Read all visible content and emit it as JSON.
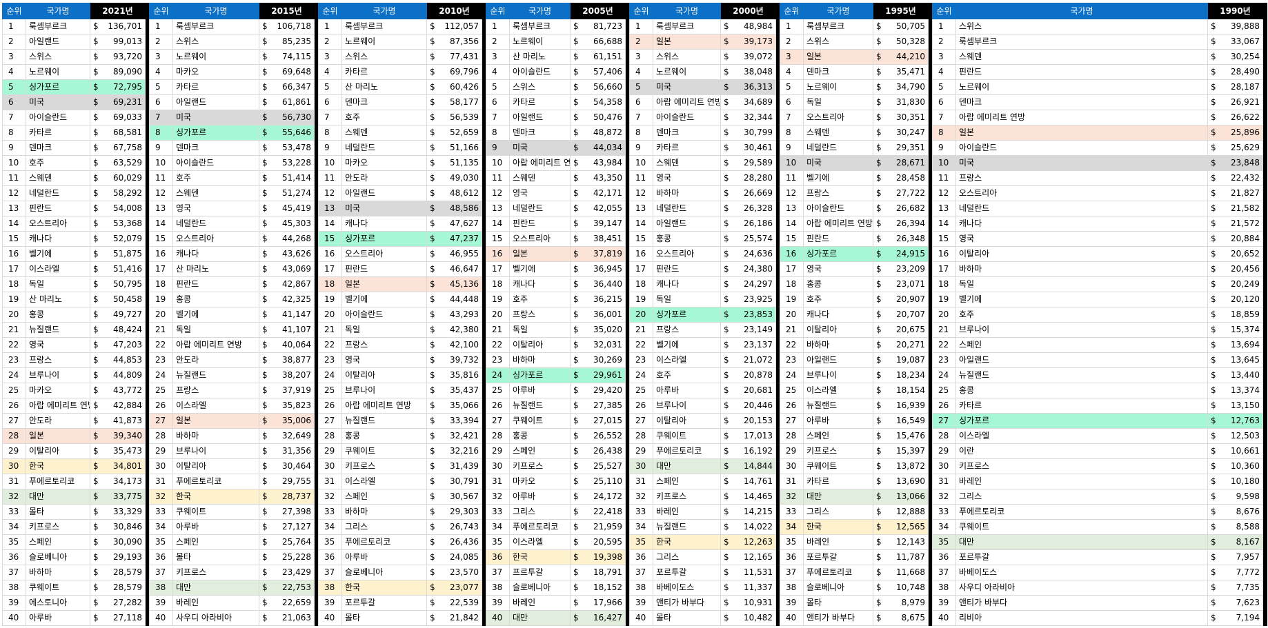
{
  "header": {
    "rank": "순위",
    "country": "국가명"
  },
  "currency": "$",
  "highlight_colors": {
    "싱가포르": "#a6f7d5",
    "미국": "#d9d9d9",
    "일본": "#fce3d8",
    "한국": "#fef1cd",
    "대만": "#e1eedd"
  },
  "tables": [
    {
      "year": "2021년",
      "rows": [
        [
          "룩셈부르크",
          "136,701"
        ],
        [
          "아일랜드",
          "99,013"
        ],
        [
          "스위스",
          "93,720"
        ],
        [
          "노르웨이",
          "89,090"
        ],
        [
          "싱가포르",
          "72,795"
        ],
        [
          "미국",
          "69,231"
        ],
        [
          "아이슬란드",
          "69,033"
        ],
        [
          "카타르",
          "68,581"
        ],
        [
          "덴마크",
          "67,758"
        ],
        [
          "호주",
          "63,529"
        ],
        [
          "스웨덴",
          "60,029"
        ],
        [
          "네덜란드",
          "58,292"
        ],
        [
          "핀란드",
          "54,008"
        ],
        [
          "오스트리아",
          "53,368"
        ],
        [
          "캐나다",
          "52,079"
        ],
        [
          "벨기에",
          "51,875"
        ],
        [
          "이스라엘",
          "51,416"
        ],
        [
          "독일",
          "50,795"
        ],
        [
          "산 마리노",
          "50,458"
        ],
        [
          "홍콩",
          "49,727"
        ],
        [
          "뉴질랜드",
          "48,424"
        ],
        [
          "영국",
          "47,203"
        ],
        [
          "프랑스",
          "44,853"
        ],
        [
          "브루나이",
          "44,809"
        ],
        [
          "마카오",
          "43,772"
        ],
        [
          "아랍 에미리트 연방",
          "42,884"
        ],
        [
          "안도라",
          "41,873"
        ],
        [
          "일본",
          "39,340"
        ],
        [
          "이탈리아",
          "35,473"
        ],
        [
          "한국",
          "34,801"
        ],
        [
          "푸에르토리코",
          "34,173"
        ],
        [
          "대만",
          "33,775"
        ],
        [
          "몰타",
          "33,329"
        ],
        [
          "키프로스",
          "30,846"
        ],
        [
          "스페인",
          "30,090"
        ],
        [
          "슬로베니아",
          "29,193"
        ],
        [
          "바하마",
          "28,579"
        ],
        [
          "쿠웨이트",
          "28,579"
        ],
        [
          "에스토니아",
          "27,282"
        ],
        [
          "아루바",
          "27,118"
        ]
      ]
    },
    {
      "year": "2015년",
      "rows": [
        [
          "룩셈부르크",
          "106,718"
        ],
        [
          "스위스",
          "85,235"
        ],
        [
          "노르웨이",
          "74,115"
        ],
        [
          "마카오",
          "69,648"
        ],
        [
          "카타르",
          "66,347"
        ],
        [
          "아일랜드",
          "61,861"
        ],
        [
          "미국",
          "56,730"
        ],
        [
          "싱가포르",
          "55,646"
        ],
        [
          "덴마크",
          "53,478"
        ],
        [
          "아이슬란드",
          "53,228"
        ],
        [
          "호주",
          "51,414"
        ],
        [
          "스웨덴",
          "51,274"
        ],
        [
          "영국",
          "45,419"
        ],
        [
          "네덜란드",
          "45,303"
        ],
        [
          "오스트리아",
          "44,268"
        ],
        [
          "캐나다",
          "43,626"
        ],
        [
          "산 마리노",
          "43,069"
        ],
        [
          "핀란드",
          "42,867"
        ],
        [
          "홍콩",
          "42,325"
        ],
        [
          "벨기에",
          "41,147"
        ],
        [
          "독일",
          "41,107"
        ],
        [
          "아랍 에미리트 연방",
          "40,064"
        ],
        [
          "안도라",
          "38,877"
        ],
        [
          "뉴질랜드",
          "38,207"
        ],
        [
          "프랑스",
          "37,919"
        ],
        [
          "이스라엘",
          "35,823"
        ],
        [
          "일본",
          "35,006"
        ],
        [
          "바하마",
          "32,649"
        ],
        [
          "브루나이",
          "31,356"
        ],
        [
          "이탈리아",
          "30,464"
        ],
        [
          "푸에르토리코",
          "29,755"
        ],
        [
          "한국",
          "28,737"
        ],
        [
          "쿠웨이트",
          "27,398"
        ],
        [
          "아루바",
          "27,127"
        ],
        [
          "스페인",
          "25,764"
        ],
        [
          "몰타",
          "25,228"
        ],
        [
          "키프로스",
          "23,429"
        ],
        [
          "대만",
          "22,753"
        ],
        [
          "바레인",
          "22,659"
        ],
        [
          "사우디 아라비아",
          "21,063"
        ]
      ]
    },
    {
      "year": "2010년",
      "rows": [
        [
          "룩셈부르크",
          "112,057"
        ],
        [
          "노르웨이",
          "87,356"
        ],
        [
          "스위스",
          "77,431"
        ],
        [
          "카타르",
          "69,796"
        ],
        [
          "산 마리노",
          "60,426"
        ],
        [
          "덴마크",
          "58,177"
        ],
        [
          "호주",
          "56,539"
        ],
        [
          "스웨덴",
          "52,659"
        ],
        [
          "네덜란드",
          "51,166"
        ],
        [
          "마카오",
          "51,135"
        ],
        [
          "안도라",
          "49,030"
        ],
        [
          "아일랜드",
          "48,612"
        ],
        [
          "미국",
          "48,586"
        ],
        [
          "캐나다",
          "47,627"
        ],
        [
          "싱가포르",
          "47,237"
        ],
        [
          "오스트리아",
          "46,955"
        ],
        [
          "핀란드",
          "46,647"
        ],
        [
          "일본",
          "45,136"
        ],
        [
          "벨기에",
          "44,448"
        ],
        [
          "아이슬란드",
          "43,293"
        ],
        [
          "독일",
          "42,380"
        ],
        [
          "프랑스",
          "42,100"
        ],
        [
          "영국",
          "39,732"
        ],
        [
          "이탈리아",
          "35,816"
        ],
        [
          "브루나이",
          "35,437"
        ],
        [
          "아랍 에미리트 연방",
          "35,066"
        ],
        [
          "뉴질랜드",
          "33,394"
        ],
        [
          "홍콩",
          "32,421"
        ],
        [
          "쿠웨이트",
          "32,216"
        ],
        [
          "키프로스",
          "31,439"
        ],
        [
          "이스라엘",
          "30,791"
        ],
        [
          "스페인",
          "30,567"
        ],
        [
          "바하마",
          "29,303"
        ],
        [
          "그리스",
          "26,743"
        ],
        [
          "푸에르토리코",
          "26,436"
        ],
        [
          "아루바",
          "24,085"
        ],
        [
          "슬로베니아",
          "23,570"
        ],
        [
          "한국",
          "23,077"
        ],
        [
          "포르투갈",
          "22,539"
        ],
        [
          "몰타",
          "21,842"
        ]
      ]
    },
    {
      "year": "2005년",
      "rows": [
        [
          "룩셈부르크",
          "81,723"
        ],
        [
          "노르웨이",
          "66,688"
        ],
        [
          "산 마리노",
          "61,151"
        ],
        [
          "아이슬란드",
          "57,406"
        ],
        [
          "스위스",
          "56,660"
        ],
        [
          "카타르",
          "54,358"
        ],
        [
          "아일랜드",
          "50,476"
        ],
        [
          "덴마크",
          "48,872"
        ],
        [
          "미국",
          "44,034"
        ],
        [
          "아랍 에미리트 연방",
          "43,984"
        ],
        [
          "스웨덴",
          "43,350"
        ],
        [
          "영국",
          "42,171"
        ],
        [
          "네덜란드",
          "42,055"
        ],
        [
          "핀란드",
          "39,147"
        ],
        [
          "오스트리아",
          "38,451"
        ],
        [
          "일본",
          "37,819"
        ],
        [
          "벨기에",
          "36,945"
        ],
        [
          "캐나다",
          "36,440"
        ],
        [
          "호주",
          "36,215"
        ],
        [
          "프랑스",
          "36,001"
        ],
        [
          "독일",
          "35,020"
        ],
        [
          "이탈리아",
          "32,031"
        ],
        [
          "바하마",
          "30,269"
        ],
        [
          "싱가포르",
          "29,961"
        ],
        [
          "아루바",
          "29,420"
        ],
        [
          "뉴질랜드",
          "27,385"
        ],
        [
          "쿠웨이트",
          "27,015"
        ],
        [
          "홍콩",
          "26,552"
        ],
        [
          "스페인",
          "26,438"
        ],
        [
          "키프로스",
          "25,527"
        ],
        [
          "마카오",
          "25,110"
        ],
        [
          "아루바",
          "24,172"
        ],
        [
          "그리스",
          "22,418"
        ],
        [
          "푸에르토리코",
          "21,959"
        ],
        [
          "이스라엘",
          "20,595"
        ],
        [
          "한국",
          "19,398"
        ],
        [
          "프르투갈",
          "18,791"
        ],
        [
          "슬로베니아",
          "18,152"
        ],
        [
          "바레인",
          "17,966"
        ],
        [
          "대만",
          "16,427"
        ]
      ]
    },
    {
      "year": "2000년",
      "rows": [
        [
          "룩셈부르크",
          "48,984"
        ],
        [
          "일본",
          "39,173"
        ],
        [
          "스위스",
          "39,072"
        ],
        [
          "노르웨이",
          "38,048"
        ],
        [
          "미국",
          "36,313"
        ],
        [
          "아랍 에미리트 연방",
          "34,689"
        ],
        [
          "아이슬란드",
          "32,344"
        ],
        [
          "덴마크",
          "30,799"
        ],
        [
          "카타르",
          "30,461"
        ],
        [
          "스웨덴",
          "29,589"
        ],
        [
          "영국",
          "28,280"
        ],
        [
          "바하마",
          "26,669"
        ],
        [
          "네덜란드",
          "26,328"
        ],
        [
          "아일랜드",
          "26,186"
        ],
        [
          "홍콩",
          "25,574"
        ],
        [
          "오스트리아",
          "24,636"
        ],
        [
          "핀란드",
          "24,380"
        ],
        [
          "캐나다",
          "24,297"
        ],
        [
          "독일",
          "23,925"
        ],
        [
          "싱가포르",
          "23,853"
        ],
        [
          "프랑스",
          "23,149"
        ],
        [
          "벨기에",
          "23,137"
        ],
        [
          "이스라엘",
          "21,072"
        ],
        [
          "호주",
          "20,878"
        ],
        [
          "아루바",
          "20,681"
        ],
        [
          "브루나이",
          "20,446"
        ],
        [
          "이탈리아",
          "20,153"
        ],
        [
          "쿠웨이트",
          "17,013"
        ],
        [
          "푸에르토리코",
          "16,192"
        ],
        [
          "대만",
          "14,844"
        ],
        [
          "스페인",
          "14,761"
        ],
        [
          "키프로스",
          "14,465"
        ],
        [
          "바레인",
          "14,215"
        ],
        [
          "뉴질랜드",
          "14,022"
        ],
        [
          "한국",
          "12,263"
        ],
        [
          "그리스",
          "12,165"
        ],
        [
          "포르투갈",
          "11,531"
        ],
        [
          "바베이도스",
          "11,337"
        ],
        [
          "앤티가 바부다",
          "10,931"
        ],
        [
          "몰타",
          "10,482"
        ]
      ]
    },
    {
      "year": "1995년",
      "rows": [
        [
          "룩셈부르크",
          "50,705"
        ],
        [
          "스위스",
          "50,328"
        ],
        [
          "일본",
          "44,210"
        ],
        [
          "덴마크",
          "35,471"
        ],
        [
          "노르웨이",
          "34,790"
        ],
        [
          "독일",
          "31,830"
        ],
        [
          "오스트리아",
          "30,351"
        ],
        [
          "스웨덴",
          "30,247"
        ],
        [
          "네덜란드",
          "29,351"
        ],
        [
          "미국",
          "28,671"
        ],
        [
          "벨기에",
          "28,458"
        ],
        [
          "프랑스",
          "27,722"
        ],
        [
          "아이슬란드",
          "26,682"
        ],
        [
          "아랍 에미리트 연방",
          "26,394"
        ],
        [
          "핀란드",
          "26,348"
        ],
        [
          "싱가포르",
          "24,915"
        ],
        [
          "영국",
          "23,209"
        ],
        [
          "홍콩",
          "23,071"
        ],
        [
          "호주",
          "20,907"
        ],
        [
          "캐나다",
          "20,707"
        ],
        [
          "이탈리아",
          "20,675"
        ],
        [
          "바하마",
          "20,271"
        ],
        [
          "아일랜드",
          "19,087"
        ],
        [
          "브루나이",
          "18,234"
        ],
        [
          "이스라엘",
          "18,154"
        ],
        [
          "뉴질랜드",
          "16,939"
        ],
        [
          "아루바",
          "16,549"
        ],
        [
          "스페인",
          "15,476"
        ],
        [
          "키프로스",
          "15,397"
        ],
        [
          "쿠웨이트",
          "13,872"
        ],
        [
          "카타르",
          "13,690"
        ],
        [
          "대만",
          "13,066"
        ],
        [
          "그리스",
          "12,888"
        ],
        [
          "한국",
          "12,565"
        ],
        [
          "바레인",
          "12,143"
        ],
        [
          "포르투갈",
          "11,787"
        ],
        [
          "푸에르토리코",
          "11,668"
        ],
        [
          "슬로베니아",
          "10,748"
        ],
        [
          "몰타",
          "8,979"
        ],
        [
          "앤티가 바부다",
          "8,675"
        ]
      ]
    },
    {
      "year": "1990년",
      "rows": [
        [
          "스위스",
          "39,888"
        ],
        [
          "룩셈부르크",
          "33,067"
        ],
        [
          "스웨덴",
          "30,254"
        ],
        [
          "핀란드",
          "28,490"
        ],
        [
          "노르웨이",
          "28,187"
        ],
        [
          "덴마크",
          "26,921"
        ],
        [
          "아랍 에미리트 연방",
          "26,622"
        ],
        [
          "일본",
          "25,896"
        ],
        [
          "아이슬란드",
          "25,629"
        ],
        [
          "미국",
          "23,848"
        ],
        [
          "프랑스",
          "22,432"
        ],
        [
          "오스트리아",
          "21,827"
        ],
        [
          "네덜란드",
          "21,582"
        ],
        [
          "캐나다",
          "21,572"
        ],
        [
          "영국",
          "20,884"
        ],
        [
          "이탈리아",
          "20,652"
        ],
        [
          "바하마",
          "20,456"
        ],
        [
          "독일",
          "20,249"
        ],
        [
          "벨기에",
          "20,120"
        ],
        [
          "호주",
          "18,859"
        ],
        [
          "브루나이",
          "15,374"
        ],
        [
          "스페인",
          "13,694"
        ],
        [
          "아일랜드",
          "13,645"
        ],
        [
          "뉴질랜드",
          "13,440"
        ],
        [
          "홍콩",
          "13,374"
        ],
        [
          "카타르",
          "13,150"
        ],
        [
          "싱가포르",
          "12,763"
        ],
        [
          "이스라엘",
          "12,503"
        ],
        [
          "이란",
          "10,661"
        ],
        [
          "키프로스",
          "10,360"
        ],
        [
          "바레인",
          "10,180"
        ],
        [
          "그리스",
          "9,598"
        ],
        [
          "푸에르토리코",
          "8,676"
        ],
        [
          "쿠웨이트",
          "8,588"
        ],
        [
          "대만",
          "8,167"
        ],
        [
          "포르투갈",
          "7,957"
        ],
        [
          "바베이도스",
          "7,772"
        ],
        [
          "사우디 아라비아",
          "7,735"
        ],
        [
          "앤티가 바부다",
          "7,623"
        ],
        [
          "리비아",
          "7,194"
        ]
      ]
    }
  ]
}
